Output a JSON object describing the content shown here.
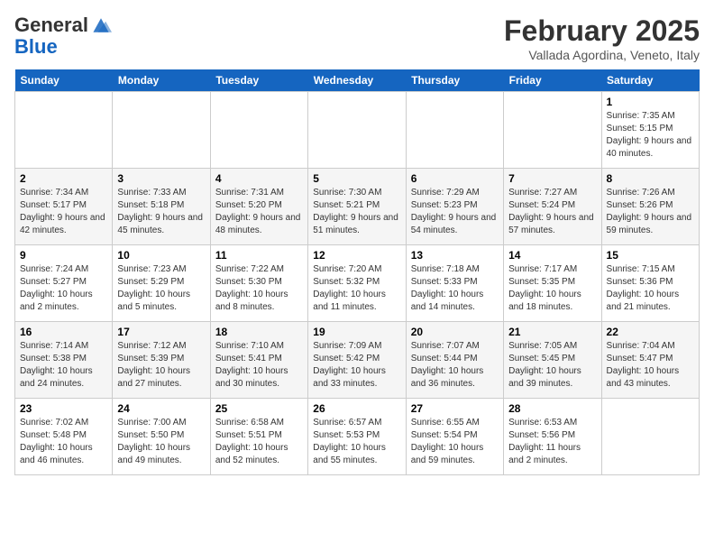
{
  "header": {
    "logo_general": "General",
    "logo_blue": "Blue",
    "month_title": "February 2025",
    "location": "Vallada Agordina, Veneto, Italy"
  },
  "days_of_week": [
    "Sunday",
    "Monday",
    "Tuesday",
    "Wednesday",
    "Thursday",
    "Friday",
    "Saturday"
  ],
  "weeks": [
    [
      {
        "day": "",
        "info": ""
      },
      {
        "day": "",
        "info": ""
      },
      {
        "day": "",
        "info": ""
      },
      {
        "day": "",
        "info": ""
      },
      {
        "day": "",
        "info": ""
      },
      {
        "day": "",
        "info": ""
      },
      {
        "day": "1",
        "info": "Sunrise: 7:35 AM\nSunset: 5:15 PM\nDaylight: 9 hours and 40 minutes."
      }
    ],
    [
      {
        "day": "2",
        "info": "Sunrise: 7:34 AM\nSunset: 5:17 PM\nDaylight: 9 hours and 42 minutes."
      },
      {
        "day": "3",
        "info": "Sunrise: 7:33 AM\nSunset: 5:18 PM\nDaylight: 9 hours and 45 minutes."
      },
      {
        "day": "4",
        "info": "Sunrise: 7:31 AM\nSunset: 5:20 PM\nDaylight: 9 hours and 48 minutes."
      },
      {
        "day": "5",
        "info": "Sunrise: 7:30 AM\nSunset: 5:21 PM\nDaylight: 9 hours and 51 minutes."
      },
      {
        "day": "6",
        "info": "Sunrise: 7:29 AM\nSunset: 5:23 PM\nDaylight: 9 hours and 54 minutes."
      },
      {
        "day": "7",
        "info": "Sunrise: 7:27 AM\nSunset: 5:24 PM\nDaylight: 9 hours and 57 minutes."
      },
      {
        "day": "8",
        "info": "Sunrise: 7:26 AM\nSunset: 5:26 PM\nDaylight: 9 hours and 59 minutes."
      }
    ],
    [
      {
        "day": "9",
        "info": "Sunrise: 7:24 AM\nSunset: 5:27 PM\nDaylight: 10 hours and 2 minutes."
      },
      {
        "day": "10",
        "info": "Sunrise: 7:23 AM\nSunset: 5:29 PM\nDaylight: 10 hours and 5 minutes."
      },
      {
        "day": "11",
        "info": "Sunrise: 7:22 AM\nSunset: 5:30 PM\nDaylight: 10 hours and 8 minutes."
      },
      {
        "day": "12",
        "info": "Sunrise: 7:20 AM\nSunset: 5:32 PM\nDaylight: 10 hours and 11 minutes."
      },
      {
        "day": "13",
        "info": "Sunrise: 7:18 AM\nSunset: 5:33 PM\nDaylight: 10 hours and 14 minutes."
      },
      {
        "day": "14",
        "info": "Sunrise: 7:17 AM\nSunset: 5:35 PM\nDaylight: 10 hours and 18 minutes."
      },
      {
        "day": "15",
        "info": "Sunrise: 7:15 AM\nSunset: 5:36 PM\nDaylight: 10 hours and 21 minutes."
      }
    ],
    [
      {
        "day": "16",
        "info": "Sunrise: 7:14 AM\nSunset: 5:38 PM\nDaylight: 10 hours and 24 minutes."
      },
      {
        "day": "17",
        "info": "Sunrise: 7:12 AM\nSunset: 5:39 PM\nDaylight: 10 hours and 27 minutes."
      },
      {
        "day": "18",
        "info": "Sunrise: 7:10 AM\nSunset: 5:41 PM\nDaylight: 10 hours and 30 minutes."
      },
      {
        "day": "19",
        "info": "Sunrise: 7:09 AM\nSunset: 5:42 PM\nDaylight: 10 hours and 33 minutes."
      },
      {
        "day": "20",
        "info": "Sunrise: 7:07 AM\nSunset: 5:44 PM\nDaylight: 10 hours and 36 minutes."
      },
      {
        "day": "21",
        "info": "Sunrise: 7:05 AM\nSunset: 5:45 PM\nDaylight: 10 hours and 39 minutes."
      },
      {
        "day": "22",
        "info": "Sunrise: 7:04 AM\nSunset: 5:47 PM\nDaylight: 10 hours and 43 minutes."
      }
    ],
    [
      {
        "day": "23",
        "info": "Sunrise: 7:02 AM\nSunset: 5:48 PM\nDaylight: 10 hours and 46 minutes."
      },
      {
        "day": "24",
        "info": "Sunrise: 7:00 AM\nSunset: 5:50 PM\nDaylight: 10 hours and 49 minutes."
      },
      {
        "day": "25",
        "info": "Sunrise: 6:58 AM\nSunset: 5:51 PM\nDaylight: 10 hours and 52 minutes."
      },
      {
        "day": "26",
        "info": "Sunrise: 6:57 AM\nSunset: 5:53 PM\nDaylight: 10 hours and 55 minutes."
      },
      {
        "day": "27",
        "info": "Sunrise: 6:55 AM\nSunset: 5:54 PM\nDaylight: 10 hours and 59 minutes."
      },
      {
        "day": "28",
        "info": "Sunrise: 6:53 AM\nSunset: 5:56 PM\nDaylight: 11 hours and 2 minutes."
      },
      {
        "day": "",
        "info": ""
      }
    ]
  ]
}
